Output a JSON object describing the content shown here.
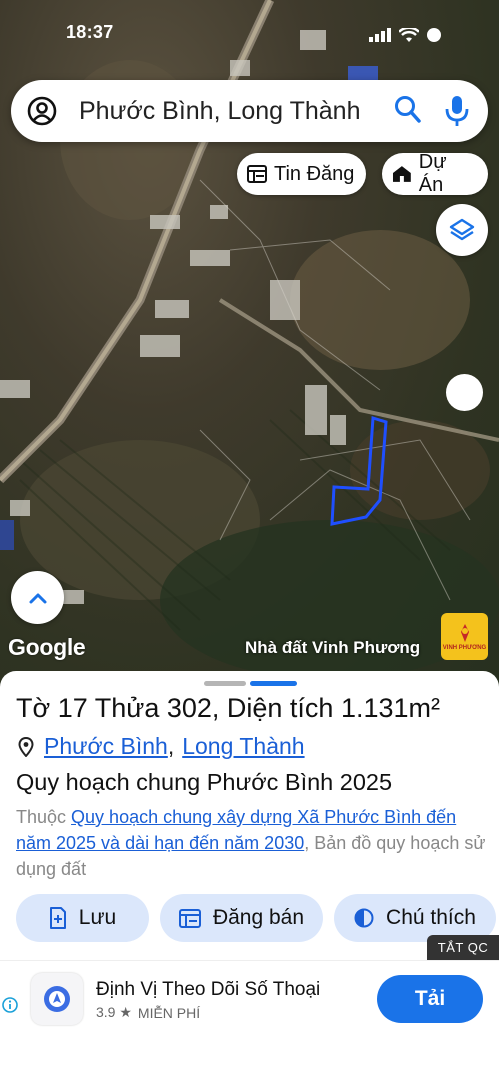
{
  "status_bar": {
    "time": "18:37"
  },
  "search": {
    "query": "Phước Bình, Long Thành"
  },
  "map_chips": {
    "listing_label": "Tin Đăng",
    "project_label": "Dự Án"
  },
  "map": {
    "provider_logo": "Google",
    "credit": "Nhà đất Vinh Phương",
    "parcel_outline_color": "#1f4fff"
  },
  "parcel": {
    "title": "Tờ 17 Thửa 302, Diện tích 1.131m²",
    "ward": "Phước Bình",
    "district": "Long Thành",
    "plan_title": "Quy hoạch chung Phước Bình 2025",
    "desc_prefix": "Thuộc",
    "desc_link": "Quy hoạch chung xây dựng Xã Phước Bình đến năm 2025 và dài hạn đến năm 2030",
    "desc_suffix": ", Bản đồ quy hoạch sử dụng đất"
  },
  "actions": {
    "save": "Lưu",
    "sell": "Đăng bán",
    "legend": "Chú thích"
  },
  "ad": {
    "tag": "TẮT QC",
    "title": "Định Vị Theo Dõi Số Thoại",
    "rating": "3.9 ★",
    "price": "MIỄN PHÍ",
    "cta": "Tải"
  },
  "colors": {
    "accent": "#1a73e8",
    "button_bg": "#dbe7fb",
    "link": "#1a5fd6"
  },
  "icons": [
    "profile-icon",
    "search-icon",
    "mic-icon",
    "listing-icon",
    "project-house-icon",
    "layers-icon",
    "chevron-up-icon",
    "location-pin-icon",
    "add-doc-icon",
    "calendar-post-icon",
    "contrast-icon",
    "info-icon",
    "location-app-icon"
  ]
}
